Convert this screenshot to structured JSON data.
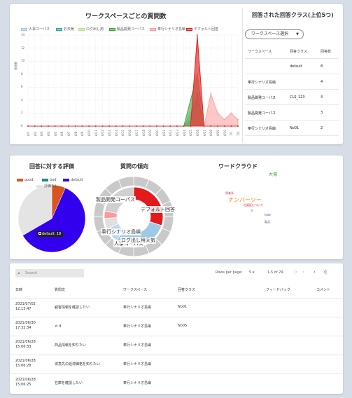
{
  "colors": {
    "series": [
      "#9ec9e6",
      "#2aa3a3",
      "#b2df8a",
      "#33a02c",
      "#fb9a99",
      "#e31a1c"
    ],
    "pie_default": "#3300ee",
    "pie_good": "#d9541e",
    "pie_bad": "#1a8a8a",
    "pie_none": "#e4e4e4"
  },
  "card1": {
    "title": "ワークスペースごとの質問数",
    "y_axis_label": "質問数",
    "right_title": "回答された回答クラス(上位5つ)",
    "select_label": "ワークスペース選択",
    "table_headers": [
      "ワークスペース",
      "回答クラス",
      "回答数"
    ],
    "table_rows": [
      [
        "",
        "default",
        "8"
      ],
      [
        "奉行シナリオ島嶼",
        "",
        "4"
      ],
      [
        "製品開発コーパス",
        "CLS_123",
        "4"
      ],
      [
        "製品開発コーパス",
        "",
        "3"
      ],
      [
        "奉行シナリオ島嶼",
        "No01",
        "2"
      ]
    ]
  },
  "chart_data": [
    {
      "type": "area",
      "title": "ワークスペースごとの質問数",
      "ylabel": "質問数",
      "ylim": [
        0,
        14
      ],
      "y_ticks": [
        "0",
        "2",
        "4",
        "6",
        "8",
        "10",
        "12",
        "14"
      ],
      "x": [
        "6/1",
        "6/2",
        "6/3",
        "6/4",
        "6/5",
        "6/6",
        "6/7",
        "6/8",
        "6/9",
        "6/10",
        "6/11",
        "6/12",
        "6/13",
        "6/14",
        "6/15",
        "6/16",
        "6/17",
        "6/18",
        "6/19",
        "6/20",
        "6/21",
        "6/22",
        "6/23",
        "6/24",
        "6/25",
        "6/26",
        "6/27",
        "6/28",
        "6/29",
        "6/30",
        "7/1",
        "7/2"
      ],
      "series": [
        {
          "name": "人事コーパス",
          "values": [
            0,
            0,
            0,
            0,
            0,
            0,
            0,
            0,
            0,
            0,
            0,
            0,
            0,
            0,
            0,
            0,
            0,
            0,
            0,
            0,
            0,
            0,
            0,
            0,
            2,
            4,
            0,
            0,
            0,
            0,
            0,
            0
          ]
        },
        {
          "name": "お天気",
          "values": [
            0,
            0,
            0,
            0,
            0,
            0,
            0,
            0,
            0,
            0,
            0,
            0,
            0,
            0,
            0,
            0,
            0,
            0,
            0,
            0,
            0,
            0,
            0,
            0,
            1,
            5,
            0,
            0,
            0,
            0,
            0,
            0
          ]
        },
        {
          "name": "ログ出し用",
          "values": [
            0,
            0,
            0,
            0,
            0,
            0,
            0,
            0,
            0,
            0,
            0,
            0,
            0,
            0,
            0,
            0,
            0,
            0,
            0,
            0,
            0,
            0,
            0,
            0,
            1,
            3,
            0,
            0,
            0,
            0,
            0,
            0
          ]
        },
        {
          "name": "製品開発コーパス",
          "values": [
            0,
            0,
            0,
            0,
            0,
            0,
            0,
            0,
            0,
            0,
            0,
            0,
            0,
            0,
            0,
            0,
            0,
            0,
            0,
            0,
            0,
            0,
            0,
            0,
            4,
            8,
            0,
            0,
            0,
            0,
            0,
            0
          ]
        },
        {
          "name": "奉行シナリオ島嶼",
          "values": [
            0,
            0,
            0,
            0,
            0,
            0,
            0,
            0,
            0,
            0,
            0,
            0,
            0,
            0,
            0,
            0,
            0,
            0,
            0,
            0,
            0,
            0,
            0,
            0,
            0,
            13,
            0,
            5,
            2,
            1,
            2,
            1
          ]
        },
        {
          "name": "デフォルト回答",
          "values": [
            0,
            0,
            0,
            0,
            0,
            0,
            0,
            0,
            0,
            0,
            0,
            0,
            0,
            0,
            0,
            0,
            0,
            0,
            0,
            0,
            0,
            0,
            0,
            0,
            0,
            14,
            0,
            0,
            0,
            0,
            0,
            0
          ]
        }
      ],
      "legend": "top"
    },
    {
      "type": "pie",
      "title": "回答に対する評価",
      "labels": [
        "good",
        "bad",
        "default",
        "評価なし"
      ],
      "values": [
        2,
        0,
        18,
        10
      ],
      "data_label": "default: 18"
    },
    {
      "type": "pie",
      "title": "質問の傾向",
      "inner": [
        {
          "label": "製品開発コーパス",
          "value": 30,
          "color": "#e31a1c"
        },
        {
          "label": "デフォルト回答",
          "value": 30,
          "color": "#9ec9e6"
        },
        {
          "label": "お天気",
          "value": 8,
          "color": "#b9d8ea"
        },
        {
          "label": "人事コーパス",
          "value": 6,
          "color": "#e0e0e0"
        },
        {
          "label": "ログ出し用",
          "value": 4,
          "color": "#fb9a99"
        },
        {
          "label": "奉行シナリオ島嶼",
          "value": 22,
          "color": "#d0d0d0"
        }
      ],
      "labels_visible": [
        "製品開発コーパス",
        "デフォルト回答",
        "奉行シナリオ島嶼",
        "お天気",
        "人事コーパス",
        "ログ出し用"
      ]
    }
  ],
  "card2": {
    "rating_title": "回答に対する評価",
    "rating_legend": [
      "good",
      "bad",
      "default",
      "評価なし"
    ],
    "rating_tooltip": "default: 18",
    "trend_title": "質問の傾向",
    "wordcloud_title": "ワードクラウド",
    "words": [
      {
        "text": "大場",
        "color": "#33a02c"
      },
      {
        "text": "用者系",
        "color": "#e31a1c"
      },
      {
        "text": "ナンバーツー",
        "color": "#ff7f00"
      },
      {
        "text": "社員証について",
        "color": "#e31a1c"
      },
      {
        "text": "大",
        "color": "#1f78b4"
      },
      {
        "text": "hote",
        "color": "#6a3d9a"
      },
      {
        "text": "製品",
        "color": "#555555"
      }
    ]
  },
  "table": {
    "search_placeholder": "Search",
    "rows_per_page_label": "Rows per page:",
    "rows_per_page_value": "5",
    "range_text": "1-5 of 29",
    "headers": [
      "日時",
      "質問文",
      "ワークスペース",
      "回答クラス",
      "フィードバック",
      "コメント"
    ],
    "rows": [
      {
        "date": "2021/07/02",
        "time": "12:13:47",
        "question": "顧客情報を確認したい",
        "workspace": "奉行シナリオ島嶼",
        "class": "No01"
      },
      {
        "date": "2021/06/30",
        "time": "17:32:34",
        "question": "ｄｄ",
        "workspace": "奉行シナリオ島嶼",
        "class": "No05"
      },
      {
        "date": "2021/06/28",
        "time": "15:06:33",
        "question": "商品情報を知りたい",
        "workspace": "奉行シナリオ島嶼",
        "class": ""
      },
      {
        "date": "2021/06/28",
        "time": "15:06:28",
        "question": "得意先の延滞価格を知りたい",
        "workspace": "奉行シナリオ島嶼",
        "class": ""
      },
      {
        "date": "2021/06/28",
        "time": "15:06:25",
        "question": "在庫を確認したい",
        "workspace": "奉行シナリオ島嶼",
        "class": ""
      }
    ]
  }
}
